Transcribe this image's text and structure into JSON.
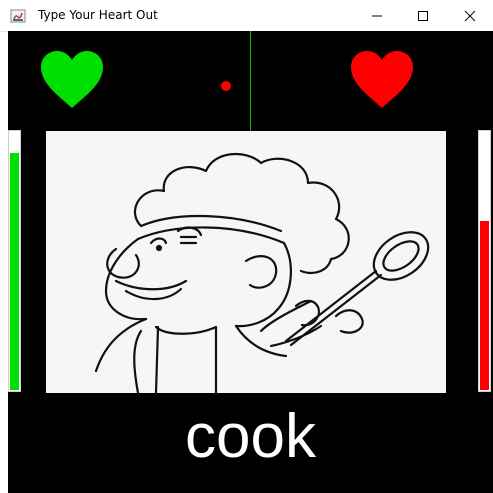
{
  "window": {
    "title": "Type Your Heart Out",
    "controls": [
      "minimize-icon",
      "maximize-icon",
      "close-icon"
    ]
  },
  "game": {
    "left_player": {
      "heart_color": "#00e000",
      "health_fraction": 0.91,
      "bar_color": "#00e000"
    },
    "right_player": {
      "heart_color": "#ff0000",
      "health_fraction": 0.65,
      "bar_color": "#ff0000"
    },
    "ball_color": "#ff0000",
    "divider_color": "#00c000",
    "picture": "chef-drawing",
    "current_word": "cook"
  }
}
